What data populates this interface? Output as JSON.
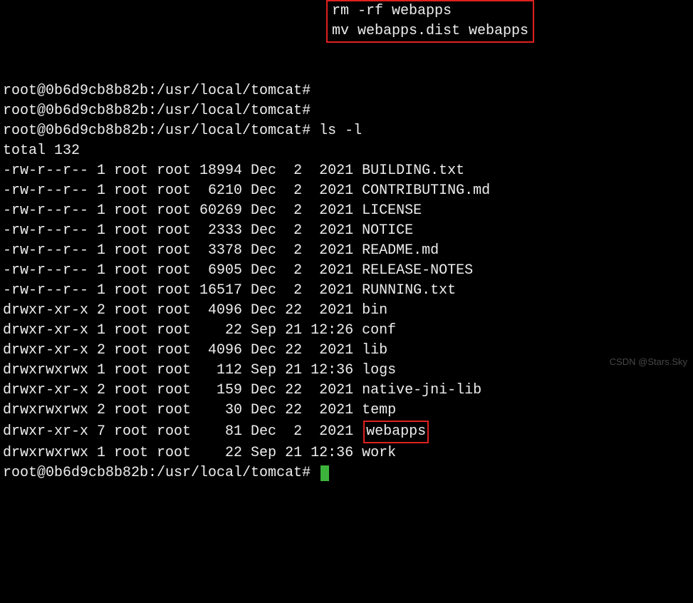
{
  "prompt": "root@0b6d9cb8b82b:/usr/local/tomcat#",
  "topCommands": {
    "cmd1": "rm -rf webapps",
    "cmd2": "mv webapps.dist webapps"
  },
  "cmd3": "ls -l",
  "total": "total 132",
  "rows": [
    {
      "perm": "-rw-r--r--",
      "links": "1",
      "owner": "root",
      "group": "root",
      "size": "18994",
      "mon": "Dec",
      "day": " 2",
      "timeyr": " 2021",
      "name": "BUILDING.txt"
    },
    {
      "perm": "-rw-r--r--",
      "links": "1",
      "owner": "root",
      "group": "root",
      "size": " 6210",
      "mon": "Dec",
      "day": " 2",
      "timeyr": " 2021",
      "name": "CONTRIBUTING.md"
    },
    {
      "perm": "-rw-r--r--",
      "links": "1",
      "owner": "root",
      "group": "root",
      "size": "60269",
      "mon": "Dec",
      "day": " 2",
      "timeyr": " 2021",
      "name": "LICENSE"
    },
    {
      "perm": "-rw-r--r--",
      "links": "1",
      "owner": "root",
      "group": "root",
      "size": " 2333",
      "mon": "Dec",
      "day": " 2",
      "timeyr": " 2021",
      "name": "NOTICE"
    },
    {
      "perm": "-rw-r--r--",
      "links": "1",
      "owner": "root",
      "group": "root",
      "size": " 3378",
      "mon": "Dec",
      "day": " 2",
      "timeyr": " 2021",
      "name": "README.md"
    },
    {
      "perm": "-rw-r--r--",
      "links": "1",
      "owner": "root",
      "group": "root",
      "size": " 6905",
      "mon": "Dec",
      "day": " 2",
      "timeyr": " 2021",
      "name": "RELEASE-NOTES"
    },
    {
      "perm": "-rw-r--r--",
      "links": "1",
      "owner": "root",
      "group": "root",
      "size": "16517",
      "mon": "Dec",
      "day": " 2",
      "timeyr": " 2021",
      "name": "RUNNING.txt"
    },
    {
      "perm": "drwxr-xr-x",
      "links": "2",
      "owner": "root",
      "group": "root",
      "size": " 4096",
      "mon": "Dec",
      "day": "22",
      "timeyr": " 2021",
      "name": "bin"
    },
    {
      "perm": "drwxr-xr-x",
      "links": "1",
      "owner": "root",
      "group": "root",
      "size": "   22",
      "mon": "Sep",
      "day": "21",
      "timeyr": "12:26",
      "name": "conf"
    },
    {
      "perm": "drwxr-xr-x",
      "links": "2",
      "owner": "root",
      "group": "root",
      "size": " 4096",
      "mon": "Dec",
      "day": "22",
      "timeyr": " 2021",
      "name": "lib"
    },
    {
      "perm": "drwxrwxrwx",
      "links": "1",
      "owner": "root",
      "group": "root",
      "size": "  112",
      "mon": "Sep",
      "day": "21",
      "timeyr": "12:36",
      "name": "logs"
    },
    {
      "perm": "drwxr-xr-x",
      "links": "2",
      "owner": "root",
      "group": "root",
      "size": "  159",
      "mon": "Dec",
      "day": "22",
      "timeyr": " 2021",
      "name": "native-jni-lib"
    },
    {
      "perm": "drwxrwxrwx",
      "links": "2",
      "owner": "root",
      "group": "root",
      "size": "   30",
      "mon": "Dec",
      "day": "22",
      "timeyr": " 2021",
      "name": "temp"
    },
    {
      "perm": "drwxr-xr-x",
      "links": "7",
      "owner": "root",
      "group": "root",
      "size": "   81",
      "mon": "Dec",
      "day": " 2",
      "timeyr": " 2021",
      "name": "webapps",
      "highlight": true
    },
    {
      "perm": "drwxrwxrwx",
      "links": "1",
      "owner": "root",
      "group": "root",
      "size": "   22",
      "mon": "Sep",
      "day": "21",
      "timeyr": "12:36",
      "name": "work"
    }
  ],
  "watermark": "CSDN @Stars.Sky"
}
